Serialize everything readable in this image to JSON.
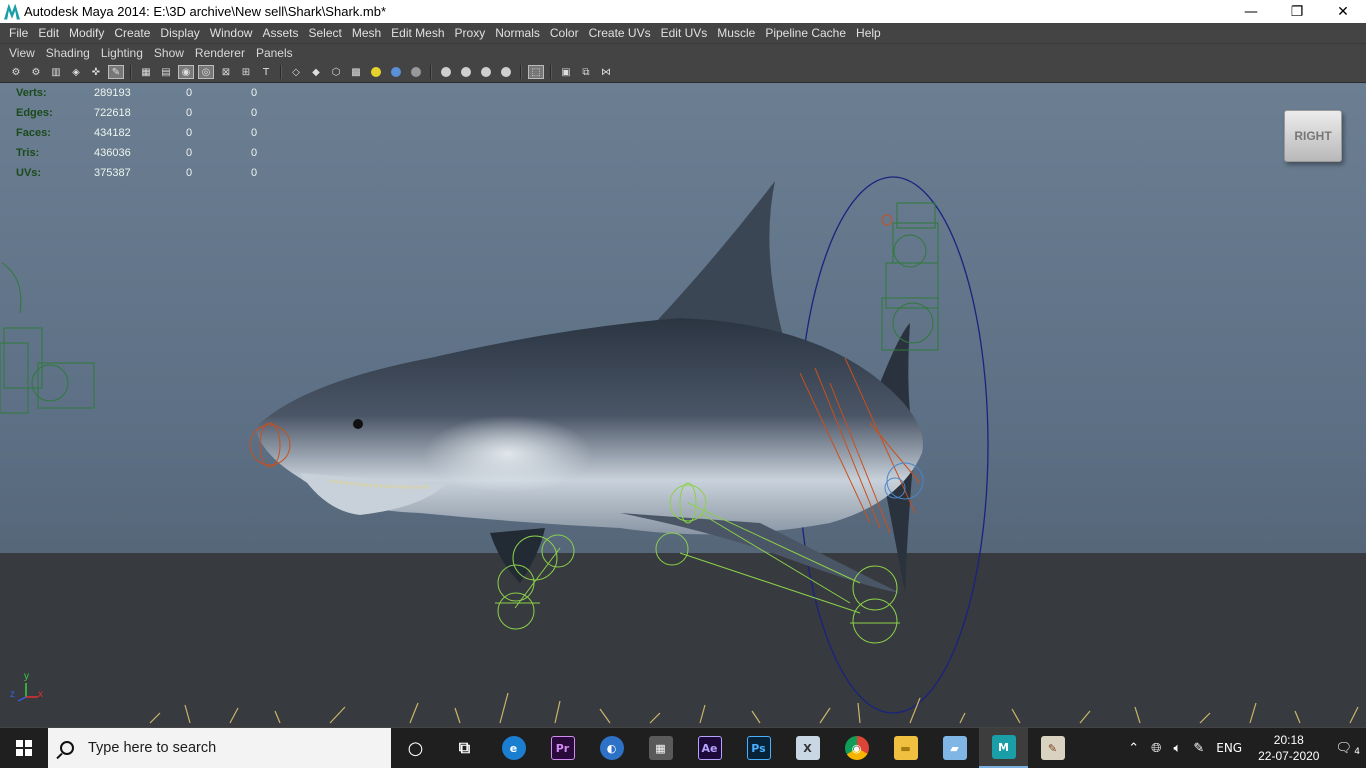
{
  "window": {
    "title": "Autodesk Maya 2014: E:\\3D archive\\New sell\\Shark\\Shark.mb*",
    "controls": {
      "minimize": "—",
      "restore": "❐",
      "close": "✕"
    }
  },
  "main_menu": [
    "File",
    "Edit",
    "Modify",
    "Create",
    "Display",
    "Window",
    "Assets",
    "Select",
    "Mesh",
    "Edit Mesh",
    "Proxy",
    "Normals",
    "Color",
    "Create UVs",
    "Edit UVs",
    "Muscle",
    "Pipeline Cache",
    "Help"
  ],
  "panel_menu": [
    "View",
    "Shading",
    "Lighting",
    "Show",
    "Renderer",
    "Panels"
  ],
  "hud": {
    "rows": [
      {
        "label": "Verts:",
        "v1": "289193",
        "v2": "0",
        "v3": "0"
      },
      {
        "label": "Edges:",
        "v1": "722618",
        "v2": "0",
        "v3": "0"
      },
      {
        "label": "Faces:",
        "v1": "434182",
        "v2": "0",
        "v3": "0"
      },
      {
        "label": "Tris:",
        "v1": "436036",
        "v2": "0",
        "v3": "0"
      },
      {
        "label": "UVs:",
        "v1": "375387",
        "v2": "0",
        "v3": "0"
      }
    ]
  },
  "viewcube": {
    "label": "RIGHT"
  },
  "axis": {
    "y": "y",
    "z": "z",
    "x": "x"
  },
  "taskbar": {
    "search_placeholder": "Type here to search",
    "apps": [
      {
        "name": "cortana",
        "glyph": "○"
      },
      {
        "name": "task-view",
        "glyph": "⧉"
      },
      {
        "name": "edge",
        "glyph": "e"
      },
      {
        "name": "premiere",
        "glyph": "Pr"
      },
      {
        "name": "blender-like",
        "glyph": "◐"
      },
      {
        "name": "calendar-app",
        "glyph": "▦"
      },
      {
        "name": "after-effects",
        "glyph": "Ae"
      },
      {
        "name": "photoshop",
        "glyph": "Ps"
      },
      {
        "name": "app-x",
        "glyph": "X"
      },
      {
        "name": "chrome",
        "glyph": "◉"
      },
      {
        "name": "file-explorer",
        "glyph": "▬"
      },
      {
        "name": "app-blue",
        "glyph": "▰"
      },
      {
        "name": "maya",
        "glyph": "M"
      },
      {
        "name": "paint",
        "glyph": "✎"
      }
    ],
    "language": "ENG",
    "time": "20:18",
    "date": "22-07-2020",
    "notifications": "4"
  },
  "colors": {
    "maya_bg": "#444444",
    "viewport_top": "#6b7e92",
    "ground": "#373a3e",
    "taskbar": "#1f1f1f",
    "rig_green": "#2e7a3a",
    "rig_lime": "#8bd14a",
    "rig_orange": "#c8501e",
    "rig_navy": "#1a237e"
  }
}
